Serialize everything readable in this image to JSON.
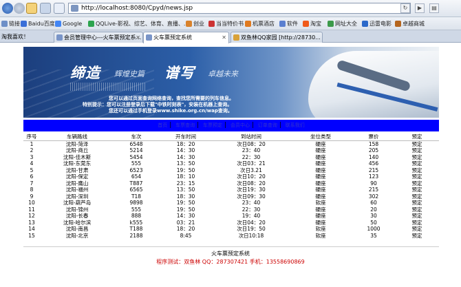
{
  "browser": {
    "url": "http://localhost:8080/Cpyd/news.jsp",
    "refresh_label": "↻",
    "forward_label": "▶",
    "page_icon_label": "▤"
  },
  "favorites": [
    {
      "label": "链接",
      "color": "#6d8fc7"
    },
    {
      "label": "Baidu百度",
      "color": "#3a6fd8"
    },
    {
      "label": "Google",
      "color": "#4285f4"
    },
    {
      "label": "QQLive-影视、综艺、体育、直播、...",
      "color": "#2da44e"
    },
    {
      "label": "创业",
      "color": "#d9822b"
    },
    {
      "label": "当当特价书",
      "color": "#c33"
    },
    {
      "label": "机票酒店",
      "color": "#e07a1f"
    },
    {
      "label": "软件",
      "color": "#5a7fd0"
    },
    {
      "label": "淘宝",
      "color": "#f05a1a"
    },
    {
      "label": "网址大全",
      "color": "#3c9a4a"
    },
    {
      "label": "迅雷电影",
      "color": "#2b68c9"
    },
    {
      "label": "卓越商城",
      "color": "#b5651d"
    }
  ],
  "tabs": [
    {
      "label": "淘我喜欢！"
    },
    {
      "label": "会员管理中心---火车票预定系..."
    },
    {
      "label": "火车票预定系统"
    },
    {
      "label": "双鱼林QQ家园 [http://28730..."
    }
  ],
  "banner": {
    "title1": "缔造",
    "sub1": "辉煌史篇",
    "title2": "谱写",
    "sub2": "卓越未来",
    "note1": "您可以通过页面查询网络查询，查找您所需要的列车信息。",
    "note2": "特别提示：您可以注册登录后下载\"中铁时刻表\"，安装在机器上查询。",
    "note3": "您还可以通过手机登录www.shike.org.cn/wap查询。"
  },
  "nav_links": [
    "首页",
    "车票查询",
    "车票预定",
    "会员中心",
    "订单查询",
    "联系我们"
  ],
  "table": {
    "headers": [
      "序号",
      "车辆路线",
      "车次",
      "开车时间",
      "到站时间",
      "坐位类型",
      "票价",
      "预定"
    ],
    "rows": [
      [
        "1",
        "沈阳-菏泽",
        "6548",
        "18：20",
        "次日08：20",
        "硬座",
        "158",
        "预定"
      ],
      [
        "2",
        "沈阳-商丘",
        "5214",
        "14：30",
        "23：40",
        "硬座",
        "205",
        "预定"
      ],
      [
        "3",
        "沈阳-佳木斯",
        "5454",
        "14：30",
        "22：30",
        "硬座",
        "140",
        "预定"
      ],
      [
        "4",
        "沈阳-东莞东",
        "555",
        "13：50",
        "次日03：21",
        "硬座",
        "456",
        "预定"
      ],
      [
        "5",
        "沈阳-甘肃",
        "6523",
        "19：50",
        "次日3.21",
        "硬座",
        "215",
        "预定"
      ],
      [
        "6",
        "沈阳-保定",
        "654",
        "18：10",
        "次日10：20",
        "硬座",
        "123",
        "预定"
      ],
      [
        "7",
        "沈阳-鹰山",
        "T887",
        "23：15",
        "次日08：20",
        "硬座",
        "90",
        "预定"
      ],
      [
        "8",
        "沈阳-福州",
        "6565",
        "13：50",
        "次日19：30",
        "硬座",
        "215",
        "预定"
      ],
      [
        "9",
        "沈阳-深圳",
        "T18",
        "18：30",
        "次日09：30",
        "硬座",
        "302",
        "预定"
      ],
      [
        "10",
        "沈阳-葫芦岛",
        "9898",
        "19：50",
        "23：40",
        "软座",
        "60",
        "预定"
      ],
      [
        "11",
        "沈阳-锦州",
        "555",
        "19：50",
        "22：30",
        "硬座",
        "20",
        "预定"
      ],
      [
        "12",
        "沈阳-长春",
        "888",
        "14：30",
        "19：40",
        "硬座",
        "30",
        "预定"
      ],
      [
        "13",
        "沈阳-哈尔滨",
        "k555",
        "03：21",
        "次日04：20",
        "硬座",
        "50",
        "预定"
      ],
      [
        "14",
        "沈阳-南昌",
        "T188",
        "18：20",
        "次日19：50",
        "软座",
        "1000",
        "预定"
      ],
      [
        "15",
        "沈阳-北京",
        "2188",
        "8:45",
        "次日10:18",
        "软座",
        "35",
        "预定"
      ]
    ]
  },
  "footer": {
    "line1": "火车票预定系统",
    "line2": "程序测试：双鱼林  QQ：287307421  手机：13558690869"
  }
}
